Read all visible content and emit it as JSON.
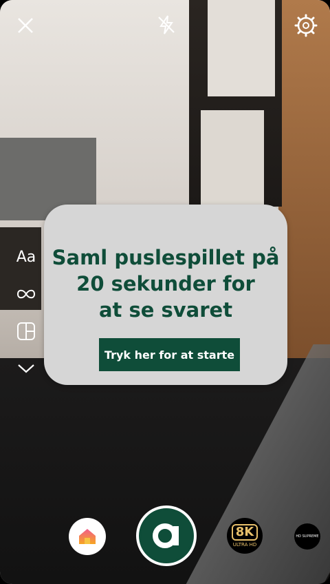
{
  "card": {
    "line1": "Saml puslespillet på",
    "line2": "20 sekunder for",
    "line3": "at se svaret",
    "button_label": "Tryk her for at starte"
  },
  "left_tools": {
    "text_tool_label": "Aa"
  },
  "bottom": {
    "k8_label": "8K",
    "k8_sub": "ULTRA HD",
    "last_label": "HD SUPREME"
  },
  "icons": {
    "close": "close-icon",
    "flash": "flash-off-icon",
    "settings": "gear-icon",
    "text": "text-icon",
    "loop": "infinity-icon",
    "layout": "layout-icon",
    "more": "chevron-down-icon",
    "home": "home-icon"
  },
  "colors": {
    "brand_green": "#0f4d39",
    "card_bg": "#d6d6d6",
    "accent_gold": "#e8c06b"
  }
}
